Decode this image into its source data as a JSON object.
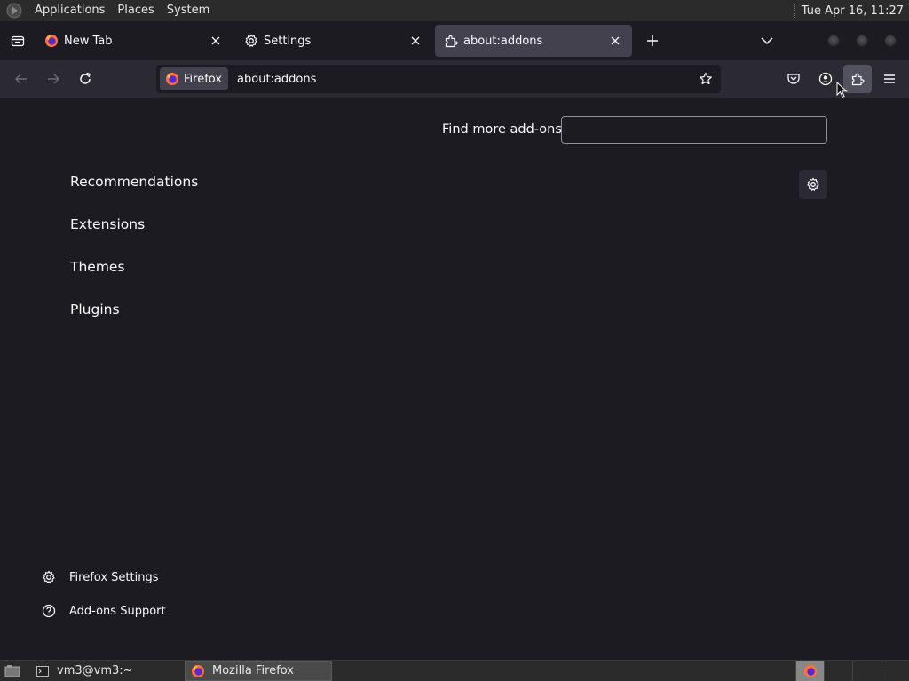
{
  "top_panel": {
    "menus": [
      "Applications",
      "Places",
      "System"
    ],
    "clock": "Tue Apr 16, 11:27"
  },
  "tabs": [
    {
      "title": "New Tab",
      "icon": "firefox-icon",
      "active": false
    },
    {
      "title": "Settings",
      "icon": "gear-icon",
      "active": false
    },
    {
      "title": "about:addons",
      "icon": "puzzle-icon",
      "active": true
    }
  ],
  "urlbar": {
    "identity_label": "Firefox",
    "url": "about:addons"
  },
  "content": {
    "find_more_label": "Find more add-ons",
    "find_more_placeholder": "",
    "categories": [
      "Recommendations",
      "Extensions",
      "Themes",
      "Plugins"
    ],
    "footer_links": [
      {
        "label": "Firefox Settings",
        "icon": "gear-icon"
      },
      {
        "label": "Add-ons Support",
        "icon": "help-icon"
      }
    ]
  },
  "taskbar": {
    "tasks": [
      {
        "label": "vm3@vm3:~",
        "icon": "terminal-icon",
        "active": false
      },
      {
        "label": "Mozilla Firefox",
        "icon": "firefox-icon",
        "active": true
      }
    ]
  },
  "colors": {
    "background": "#1c1b22",
    "toolbar": "#2b2a33",
    "active_tab": "#42414d",
    "text": "#fbfbfe"
  }
}
